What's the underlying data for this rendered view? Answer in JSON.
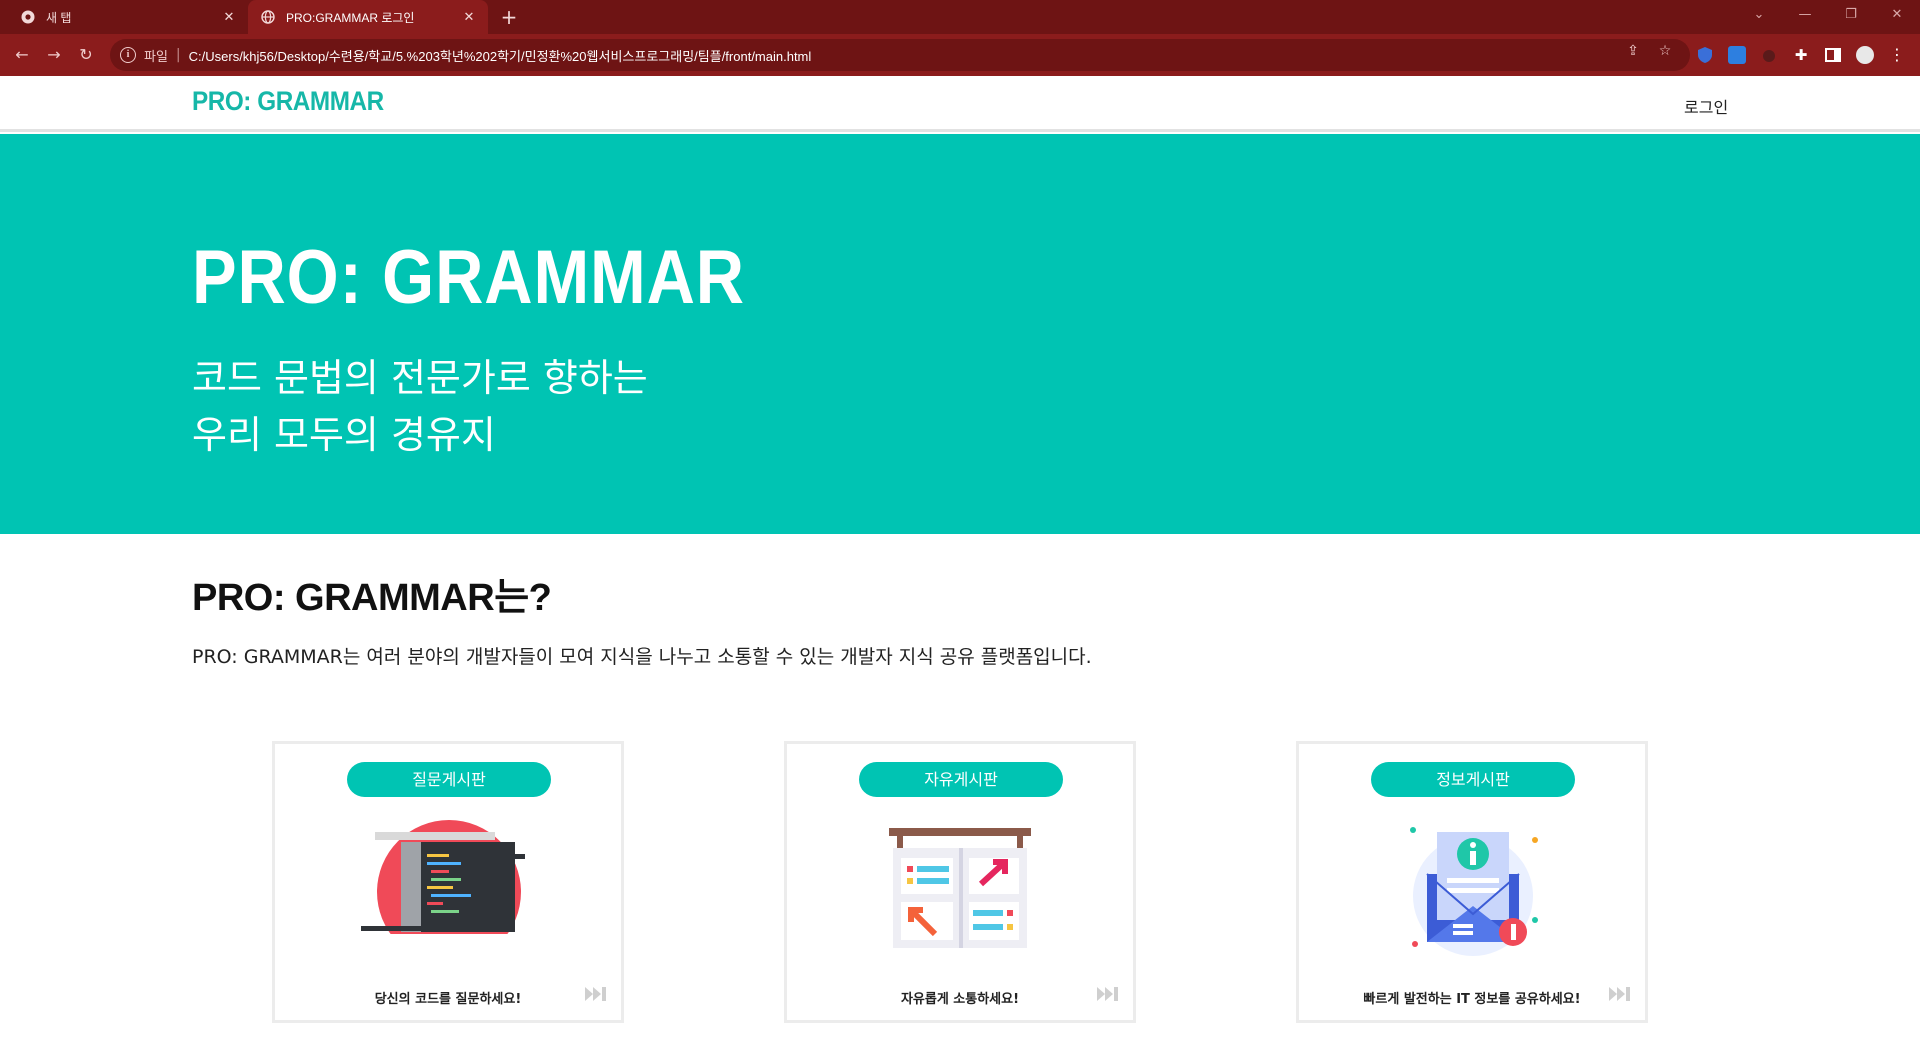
{
  "browser": {
    "tabs": [
      {
        "title": "새 탭",
        "active": false
      },
      {
        "title": "PRO:GRAMMAR 로그인",
        "active": true
      }
    ],
    "address": {
      "scheme_label": "파일",
      "url": "C:/Users/khj56/Desktop/수련용/학교/5.%203학년%202학기/민정환%20웹서비스프로그래밍/팀플/front/main.html"
    }
  },
  "header": {
    "logo": "PRO: GRAMMAR",
    "login": "로그인"
  },
  "hero": {
    "title": "PRO: GRAMMAR",
    "subtitle_line1": "코드 문법의 전문가로 향하는",
    "subtitle_line2": "우리 모두의 경유지"
  },
  "about": {
    "title": "PRO: GRAMMAR는?",
    "description": "PRO: GRAMMAR는 여러 분야의 개발자들이 모여 지식을 나누고 소통할 수 있는 개발자 지식 공유 플랫폼입니다."
  },
  "boards": [
    {
      "label": "질문게시판",
      "caption": "당신의 코드를 질문하세요!",
      "icon": "code-screen-icon"
    },
    {
      "label": "자유게시판",
      "caption": "자유롭게 소통하세요!",
      "icon": "bulletin-board-icon"
    },
    {
      "label": "정보게시판",
      "caption": "빠르게 발전하는 IT 정보를 공유하세요!",
      "icon": "info-envelope-icon"
    }
  ],
  "colors": {
    "accent": "#00c4b3",
    "logo": "#16b7a8",
    "chrome_dark": "#6e1414",
    "chrome": "#8b1c1c"
  }
}
